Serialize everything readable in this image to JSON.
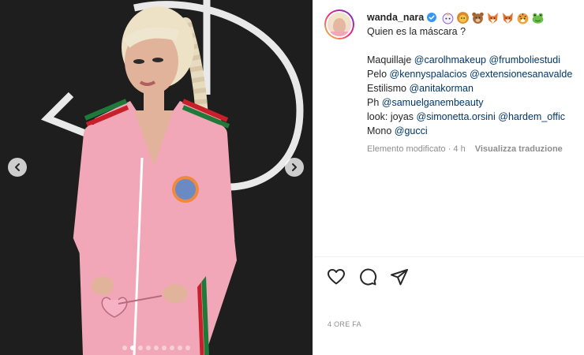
{
  "post": {
    "username": "wanda_nara",
    "emojis": [
      "unicorn-emoji",
      "lion-emoji",
      "bear-emoji",
      "fox-emoji",
      "fox-emoji",
      "tiger-emoji",
      "frog-emoji"
    ],
    "caption": {
      "first_line": "Quien es la máscara ?",
      "credits": [
        {
          "label": "Maquillaje ",
          "mentions": [
            "@carolhmakeup",
            "@frumboliestudi"
          ]
        },
        {
          "label": "Pelo ",
          "mentions": [
            "@kennyspalacios",
            "@extensionesanavalde"
          ]
        },
        {
          "label": "Estilismo ",
          "mentions": [
            "@anitakorman"
          ]
        },
        {
          "label": "Ph ",
          "mentions": [
            "@samuelganembeauty"
          ]
        },
        {
          "label": "look: joyas ",
          "mentions": [
            "@simonetta.orsini",
            "@hardem_offic"
          ]
        },
        {
          "label": "Mono ",
          "mentions": [
            "@gucci"
          ]
        }
      ]
    },
    "edited_label": "Elemento modificato · 4 h",
    "translate_label": "Visualizza traduzione",
    "time_ago": "4 ORE FA"
  },
  "carousel": {
    "dot_count": 9,
    "active_index": 1
  },
  "icons": {
    "like": "heart-icon",
    "comment": "comment-icon",
    "share": "send-icon",
    "prev": "chevron-left-icon",
    "next": "chevron-right-icon",
    "verified": "verified-badge-icon"
  },
  "colors": {
    "verified_blue": "#3897f0",
    "mention": "#00376b",
    "tracksuit_pink": "#f2a7b8",
    "gucci_green": "#1f7a3a",
    "gucci_red": "#c8202a"
  }
}
